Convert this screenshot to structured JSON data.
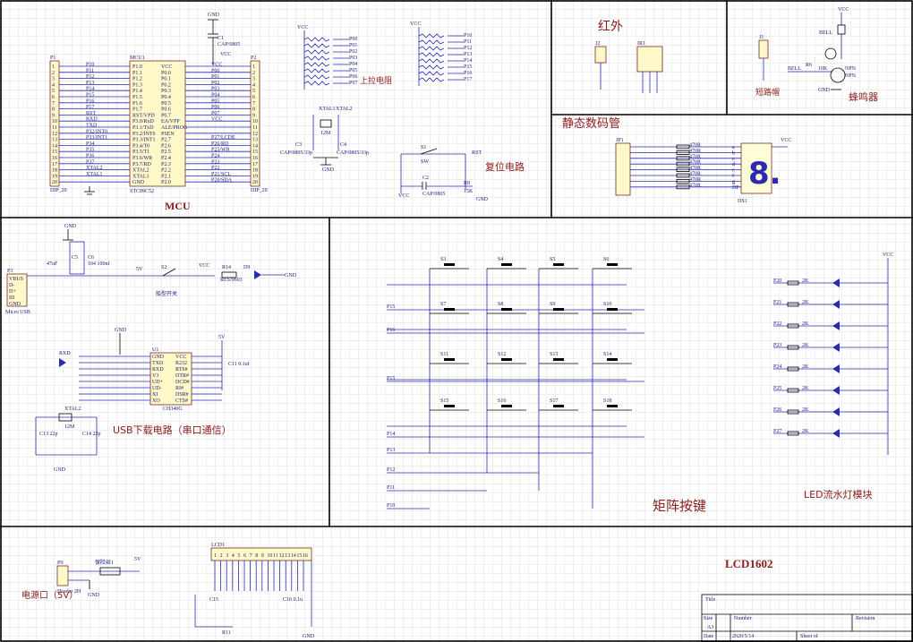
{
  "sections": {
    "mcu": "MCU",
    "pullup": "上拉电阻",
    "reset": "复位电路",
    "infrared": "红外",
    "static_seg": "静态数码管",
    "jumper": "短路帽",
    "buzzer": "蜂鸣器",
    "usb_download": "USB下载电路（串口通信）",
    "keypad": "矩阵按键",
    "led_module": "LED流水灯模块",
    "power": "电源口（5V）",
    "lcd": "LCD1602",
    "switch": "船型开关"
  },
  "mcu": {
    "ref": "MCU1",
    "part": "STC89C52",
    "p1_ref": "P1",
    "p1_type": "DIP_20",
    "p2_ref": "P2",
    "p2_type": "DIP_20",
    "left_pins": [
      "P1.0",
      "P1.1",
      "P1.2",
      "P1.3",
      "P1.4",
      "P1.5",
      "P1.6",
      "P1.7",
      "RST/VPD",
      "P3.0/RxD",
      "P3.1/TxD",
      "P3.2/INT0",
      "P3.3/INT1",
      "P3.4/T0",
      "P3.5/T1",
      "P3.6/WR",
      "P3.7/RD",
      "XTAL2",
      "XTAL1",
      "GND"
    ],
    "right_pins": [
      "VCC",
      "P0.0",
      "P0.1",
      "P0.2",
      "P0.3",
      "P0.4",
      "P0.5",
      "P0.6",
      "P0.7",
      "EA/VPP",
      "ALE/PROG",
      "PSEN",
      "P2.7",
      "P2.6",
      "P2.5",
      "P2.4",
      "P2.3",
      "P2.2",
      "P2.1",
      "P2.0"
    ],
    "left_nets": [
      "P10",
      "P11",
      "P12",
      "P13",
      "P14",
      "P15",
      "P16",
      "P17",
      "RST",
      "RXD",
      "TXD",
      "P32/INT0",
      "P33/INT1",
      "P34",
      "P35",
      "P36",
      "P37",
      "XTAL2",
      "XTAL1",
      ""
    ],
    "right_nets": [
      "VCC",
      "P00",
      "P01",
      "P02",
      "P03",
      "P04",
      "P05",
      "P06",
      "P07",
      "VCC",
      "",
      "",
      "P27/LCDE",
      "P26/RD",
      "P25/WR",
      "P24",
      "P23",
      "P22",
      "P21/SCL",
      "P20/SDA"
    ]
  },
  "labels": {
    "gnd": "GND",
    "vcc": "VCC",
    "v5": "5V",
    "c1": "C1",
    "c1_val": "CAP/0805",
    "xtal1": "XTAL1",
    "xtal1b": "XTAL2",
    "xtal_val": "12M",
    "c3": "C3",
    "c4": "C4",
    "cap33": "CAP/0805/33p",
    "s1": "S1",
    "sw": "SW",
    "rst": "RST",
    "c2": "C2",
    "c2_val": "CAP/0805",
    "r8": "R8",
    "r8_val": "15K",
    "j2": "J2",
    "ir1": "IR1",
    "ir_pins": [
      "OUT",
      "GND",
      "VDD"
    ],
    "j1": "J1",
    "bell": "BELL",
    "r_bell": "R6",
    "r_bell_val": "10K",
    "npn": "NPN",
    "jp1": "JP1",
    "ds1": "DS1",
    "seg_res": "470R",
    "seg_pins": [
      "a",
      "b",
      "c",
      "d",
      "e",
      "f",
      "g",
      "DP"
    ],
    "p3": "P3",
    "usb": "Micro USB",
    "usb_pins": [
      "VBUS",
      "D-",
      "D+",
      "ID",
      "GND"
    ],
    "c5": "C5",
    "c5_val": "47uF",
    "c6": "C6",
    "c6_val": "104 100nf",
    "s2": "S2",
    "r14": "R14",
    "r14_val": "RES/0603",
    "d9": "D9",
    "u1": "U1",
    "ch340": "CH340G",
    "ch_left": [
      "GND",
      "TXD",
      "RXD",
      "V3",
      "UD+",
      "UD-",
      "XI",
      "XO"
    ],
    "ch_right": [
      "VCC",
      "R232",
      "RTS#",
      "DTR#",
      "DCD#",
      "RI#",
      "DSR#",
      "CTS#"
    ],
    "xtal2": "XTAL2",
    "xtal2_val": "12M",
    "c13": "C13 22p",
    "c14": "C14 22p",
    "cc1": "C11 0.1uf",
    "keys": [
      "S3",
      "S4",
      "S5",
      "S6",
      "S7",
      "S8",
      "S9",
      "S10",
      "S11",
      "S12",
      "S13",
      "S14",
      "S15",
      "S16",
      "S17",
      "S18"
    ],
    "key_rows": [
      "P15",
      "P16",
      "P15",
      "P14"
    ],
    "key_cols": [
      "P13",
      "P12",
      "P11",
      "P10"
    ],
    "led_nets": [
      "P20",
      "P21",
      "P22",
      "P23",
      "P24",
      "P25",
      "P26",
      "P27"
    ],
    "led_res": "2K",
    "p0": "P0",
    "header2h": "Header 2H",
    "fuse": "保险丝1",
    "lcd1": "LCD1",
    "c15": "C15",
    "c16": "C16 0.1u",
    "r11": "R11",
    "title_block": {
      "title": "Title",
      "size": "Size",
      "size_val": "A3",
      "number": "Number",
      "revision": "Revision",
      "date": "Date",
      "date_val": "2020/5/14",
      "sheet": "Sheet of",
      "file": "D:\\Program Files\\..\\..\\SchDoc",
      "drawn": "Drawn By:"
    }
  }
}
